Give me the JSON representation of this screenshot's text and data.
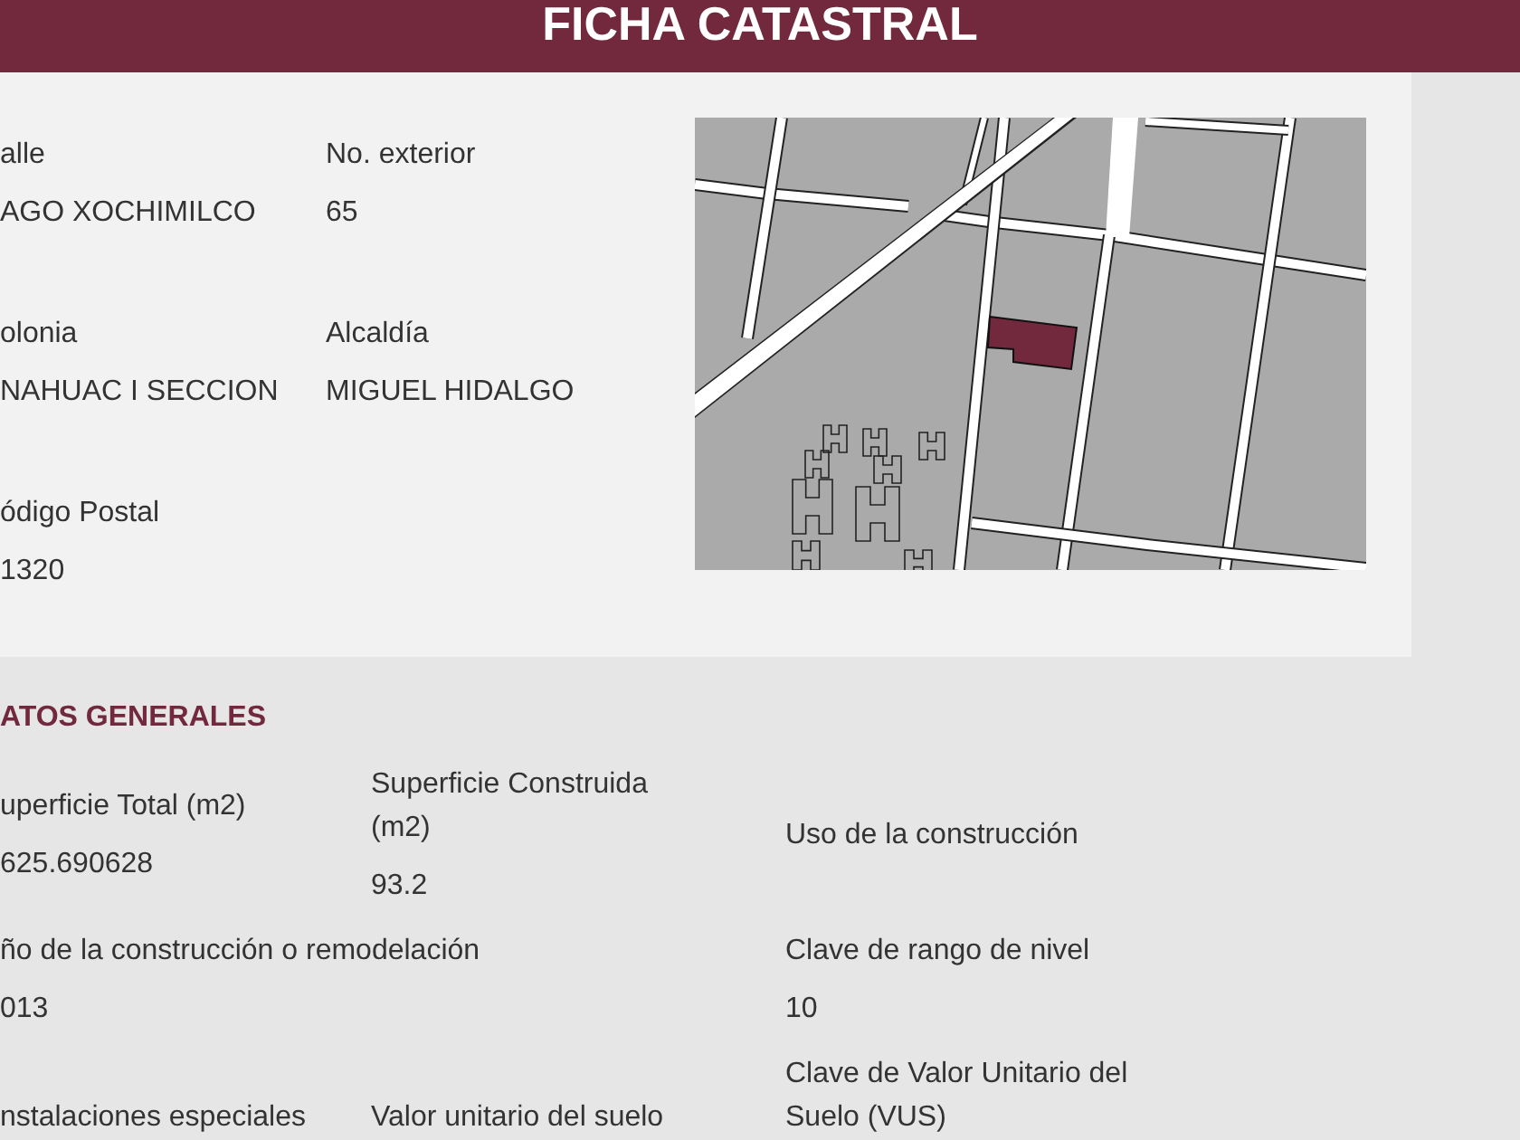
{
  "header": {
    "title": "FICHA CATASTRAL"
  },
  "address": {
    "fields": [
      {
        "label": "alle",
        "value": "AGO XOCHIMILCO"
      },
      {
        "label": "No. exterior",
        "value": "65"
      },
      {
        "label": "olonia",
        "value": "NAHUAC I SECCION"
      },
      {
        "label": "Alcaldía",
        "value": "MIGUEL HIDALGO"
      },
      {
        "label": "ódigo Postal",
        "value": "1320"
      }
    ]
  },
  "datos_generales": {
    "title": "ATOS GENERALES",
    "rows": [
      [
        {
          "label": "uperficie Total (m2)",
          "value": "625.690628"
        },
        {
          "label": "Superficie Construida (m2)",
          "value": "93.2"
        },
        {
          "label": "Uso de la construcción"
        }
      ],
      [
        {
          "label": "ño de la construcción o remodelación",
          "value": "013"
        },
        "",
        {
          "label": "Clave de rango de nivel",
          "value": "10"
        }
      ],
      [
        {
          "label": "nstalaciones especiales"
        },
        {
          "label": "Valor unitario del suelo"
        },
        {
          "label": "Clave de Valor Unitario del Suelo (VUS)"
        }
      ]
    ]
  }
}
